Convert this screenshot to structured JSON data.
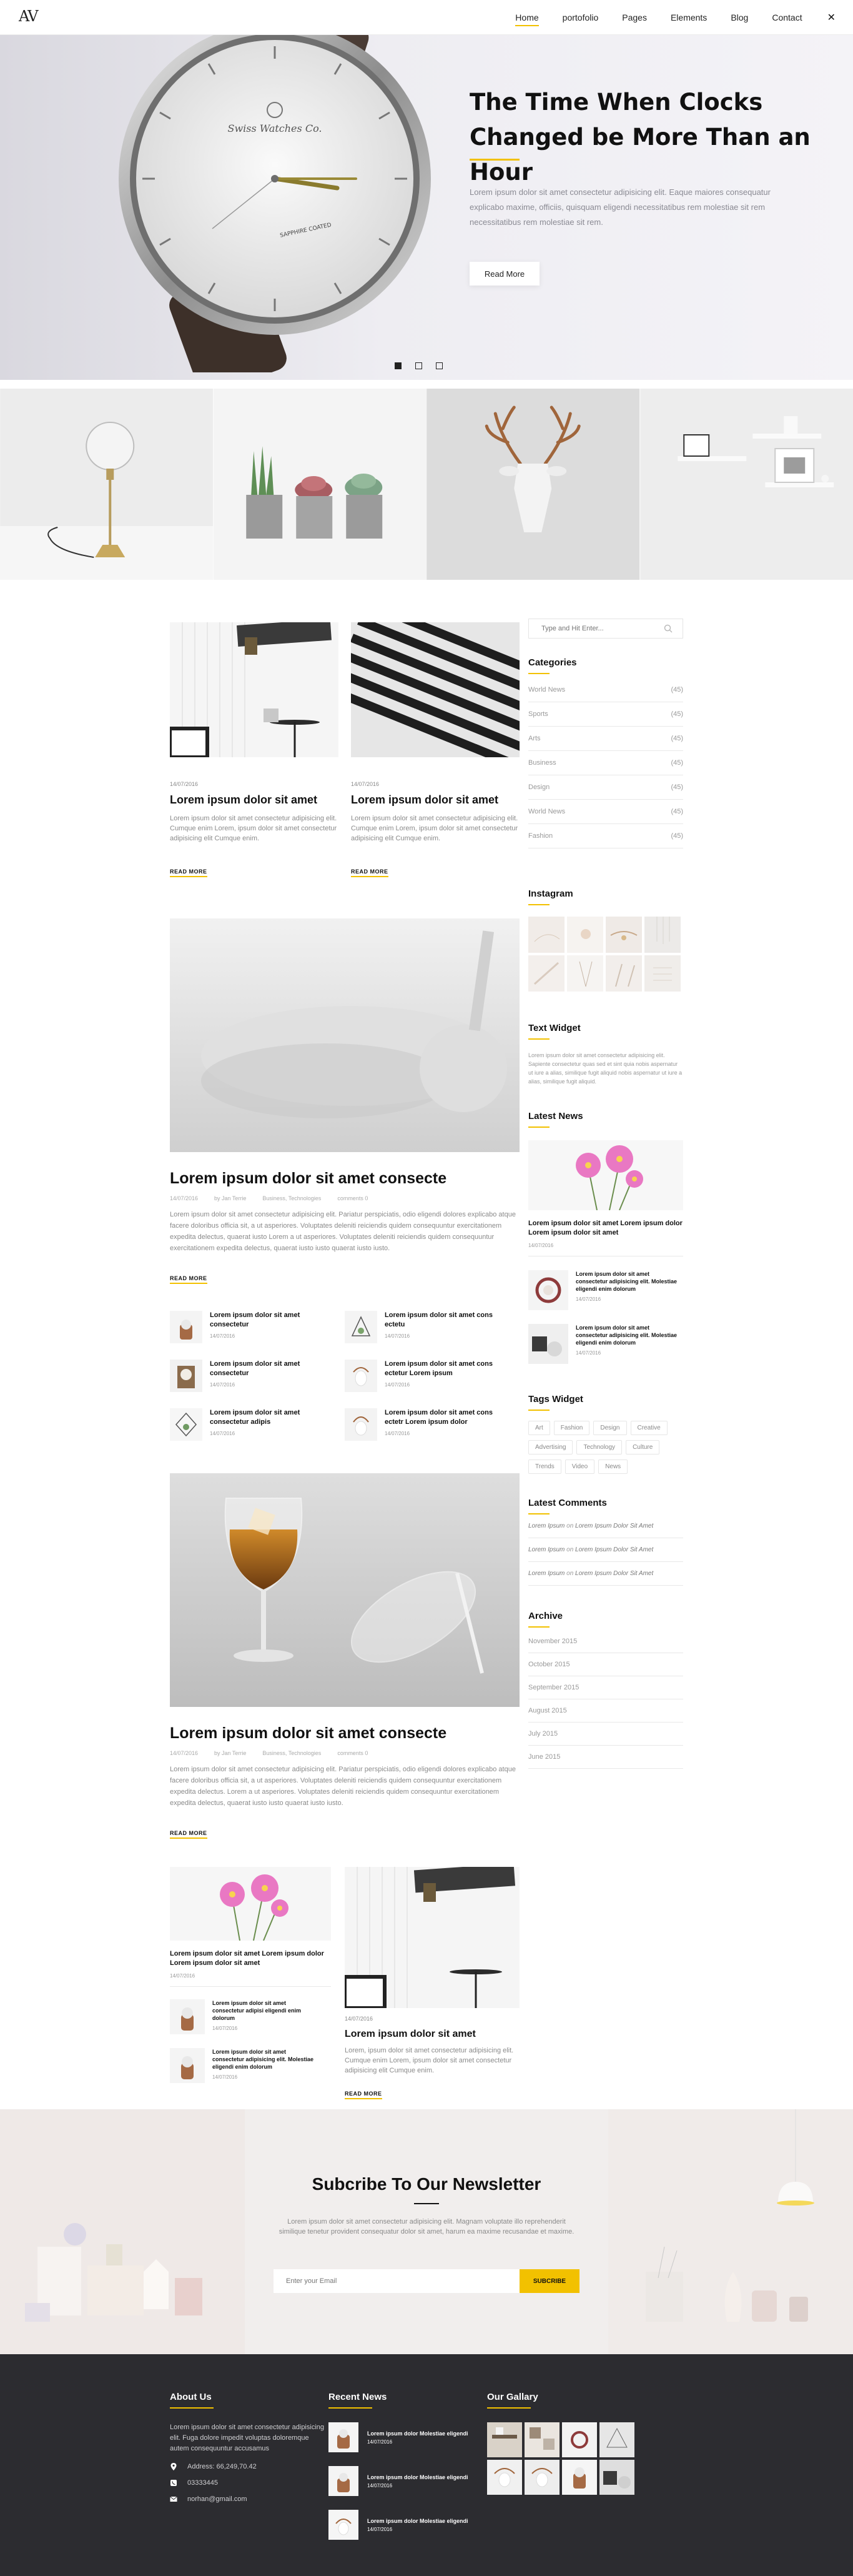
{
  "header": {
    "logo": "AV",
    "nav": [
      {
        "label": "Home",
        "active": true
      },
      {
        "label": "portofolio",
        "active": false
      },
      {
        "label": "Pages",
        "active": false
      },
      {
        "label": "Elements",
        "active": false
      },
      {
        "label": "Blog",
        "active": false
      },
      {
        "label": "Contact",
        "active": false
      }
    ],
    "close_icon": "close-icon"
  },
  "hero": {
    "title_line1": "The Time When Clocks",
    "title_line2": "Changed be More Than an Hour",
    "text": "Lorem ipsum dolor sit amet consectetur adipisicing elit. Eaque maiores consequatur explicabo maxime, officiis, quisquam eligendi necessitatibus rem molestiae sit rem necessitatibus rem molestiae sit rem.",
    "button": "Read More",
    "watch_brand": "Swiss Watches Co.",
    "watch_text": "SAPPHIRE COATED"
  },
  "posts_small": [
    {
      "date": "14/07/2016",
      "title": "Lorem ipsum dolor sit amet",
      "text": "Lorem ipsum dolor sit amet consectetur adipisicing elit. Cumque enim Lorem, ipsum dolor sit amet consectetur adipisicing elit Cumque enim.",
      "read_more": "READ MORE"
    },
    {
      "date": "14/07/2016",
      "title": "Lorem ipsum dolor sit amet",
      "text": "Lorem ipsum dolor sit amet consectetur adipisicing elit. Cumque enim Lorem, ipsum dolor sit amet consectetur adipisicing elit Cumque enim.",
      "read_more": "READ MORE"
    }
  ],
  "big_posts": [
    {
      "title": "Lorem ipsum dolor sit amet consecte",
      "meta": [
        "14/07/2016",
        "by Jan Terrie",
        "Business, Technologies",
        "comments 0"
      ],
      "text": "Lorem ipsum dolor sit amet consectetur adipisicing elit. Pariatur perspiciatis, odio eligendi dolores explicabo atque facere doloribus officia sit, a ut asperiores. Voluptates deleniti reiciendis quidem consequuntur exercitationem expedita delectus, quaerat iusto Lorem a ut asperiores. Voluptates deleniti reiciendis quidem consequuntur exercitationem expedita delectus, quaerat iusto iusto quaerat iusto iusto.",
      "read_more": "READ MORE"
    },
    {
      "title": "Lorem ipsum dolor sit amet consecte",
      "meta": [
        "14/07/2016",
        "by Jan Terrie",
        "Business, Technologies",
        "comments 0"
      ],
      "text": "Lorem ipsum dolor sit amet consectetur adipisicing elit. Pariatur perspiciatis, odio eligendi dolores explicabo atque facere doloribus officia sit, a ut asperiores. Voluptates deleniti reiciendis quidem consequuntur exercitationem expedita delectus. Lorem a ut asperiores. Voluptates deleniti reiciendis quidem consequuntur exercitationem expedita delectus, quaerat iusto iusto quaerat iusto iusto.",
      "read_more": "READ MORE"
    }
  ],
  "mini_posts": [
    {
      "title": "Lorem ipsum dolor sit amet consectetur",
      "date": "14/07/2016"
    },
    {
      "title": "Lorem ipsum dolor sit amet cons ectetu",
      "date": "14/07/2016"
    },
    {
      "title": "Lorem ipsum dolor sit amet consectetur",
      "date": "14/07/2016"
    },
    {
      "title": "Lorem ipsum dolor sit amet cons ectetur Lorem ipsum",
      "date": "14/07/2016"
    },
    {
      "title": "Lorem ipsum dolor sit amet consectetur adipis",
      "date": "14/07/2016"
    },
    {
      "title": "Lorem ipsum dolor sit amet cons ectetr Lorem ipsum dolor",
      "date": "14/07/2016"
    }
  ],
  "bottom": {
    "feature_title": "Lorem ipsum dolor sit amet Lorem ipsum dolor Lorem ipsum dolor sit amet",
    "feature_date": "14/07/2016",
    "list": [
      {
        "title": "Lorem ipsum dolor sit amet consectetur adipisi eligendi enim dolorum",
        "date": "14/07/2016"
      },
      {
        "title": "Lorem ipsum dolor sit amet consectetur adipisicing elit. Molestiae eligendi enim dolorum",
        "date": "14/07/2016"
      }
    ],
    "post": {
      "date": "14/07/2016",
      "title": "Lorem ipsum dolor sit amet",
      "text": "Lorem, ipsum dolor sit amet consectetur adipisicing elit. Cumque enim Lorem, ipsum dolor sit amet consectetur adipisicing elit Cumque enim.",
      "read_more": "READ MORE"
    }
  },
  "sidebar": {
    "search_placeholder": "Type and Hit Enter...",
    "categories_title": "Categories",
    "categories": [
      {
        "name": "World News",
        "count": "(45)"
      },
      {
        "name": "Sports",
        "count": "(45)"
      },
      {
        "name": "Arts",
        "count": "(45)"
      },
      {
        "name": "Business",
        "count": "(45)"
      },
      {
        "name": "Design",
        "count": "(45)"
      },
      {
        "name": "World News",
        "count": "(45)"
      },
      {
        "name": "Fashion",
        "count": "(45)"
      }
    ],
    "instagram_title": "Instagram",
    "text_widget_title": "Text Widget",
    "text_widget": "Lorem ipsum dolor sit amet consectetur adipisicing elit. Sapiente consectetur quas sed et sint quia nobis aspernatur ut iure a alias, similique fugit aliquid nobis aspernatur ut iure a alias, similique fugit aliquid.",
    "latest_title": "Latest News",
    "latest_big": {
      "title": "Lorem ipsum dolor sit amet Lorem ipsum dolor Lorem ipsum dolor sit amet",
      "date": "14/07/2016"
    },
    "latest_items": [
      {
        "title": "Lorem ipsum dolor sit amet consectetur adipisicing elit. Molestiae eligendi enim dolorum",
        "date": "14/07/2016"
      },
      {
        "title": "Lorem ipsum dolor sit amet consectetur adipisicing elit. Molestiae eligendi enim dolorum",
        "date": "14/07/2016"
      }
    ],
    "tags_title": "Tags Widget",
    "tags": [
      "Art",
      "Fashion",
      "Design",
      "Creative",
      "Advertising",
      "Technology",
      "Culture",
      "Trends",
      "Video",
      "News"
    ],
    "comments_title": "Latest Comments",
    "comments": [
      {
        "who": "Lorem Ipsum",
        "on": "on",
        "post": "Lorem Ipsum Dolor Sit Amet"
      },
      {
        "who": "Lorem Ipsum",
        "on": "on",
        "post": "Lorem Ipsum Dolor Sit Amet"
      },
      {
        "who": "Lorem Ipsum",
        "on": "on",
        "post": "Lorem Ipsum Dolor Sit Amet"
      }
    ],
    "archive_title": "Archive",
    "archive": [
      "November 2015",
      "October 2015",
      "September 2015",
      "August 2015",
      "July 2015",
      "June 2015"
    ]
  },
  "newsletter": {
    "title": "Subcribe To Our Newsletter",
    "text": "Lorem ipsum dolor sit amet consectetur adipisicing elit. Magnam voluptate illo reprehenderit similique tenetur provident consequatur dolor sit amet, harum ea maxime recusandae et maxime.",
    "placeholder": "Enter your Email",
    "button": "SUBCRIBE"
  },
  "footer": {
    "about_title": "About Us",
    "about_text": "Lorem ipsum dolor sit amet consectetur adipisicing elit. Fuga dolore impedit voluptas doloremque autem consequuntur accusamus",
    "address": "Address: 66,249,70.42",
    "phone": "03333445",
    "email": "norhan@gmail.com",
    "news_title": "Recent News",
    "news": [
      {
        "title": "Lorem ipsum dolor Molestiae eligendi",
        "date": "14/07/2016"
      },
      {
        "title": "Lorem ipsum dolor Molestiae eligendi",
        "date": "14/07/2016"
      },
      {
        "title": "Lorem ipsum dolor Molestiae eligendi",
        "date": "14/07/2016"
      }
    ],
    "gallery_title": "Our Gallary"
  },
  "colors": {
    "accent": "#f2c100",
    "footer": "#2c2c30",
    "text": "#111111",
    "muted": "#8a8a8a"
  }
}
